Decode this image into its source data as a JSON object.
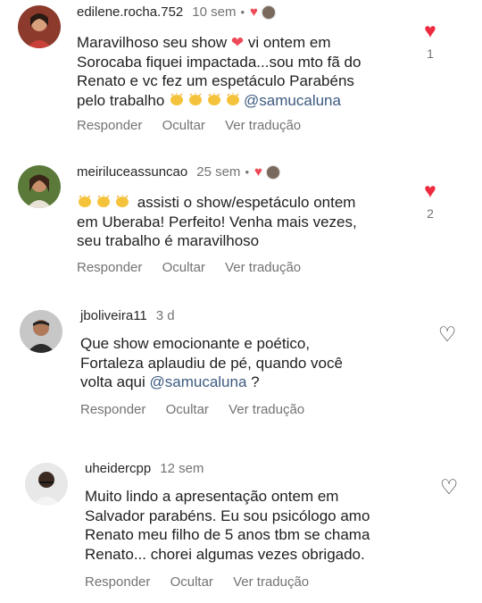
{
  "comments": [
    {
      "username": "edilene.rocha.752",
      "time": "10 sem",
      "dot": "•",
      "text_parts": [
        "Maravilhoso seu show ",
        " vi ontem em\nSorocaba fiquei impactada...sou mto fã do\nRenato e vc fez um espetáculo Parabéns\npelo trabalho "
      ],
      "mention": "@samucaluna",
      "actions": [
        "Responder",
        "Ocultar",
        "Ver tradução"
      ],
      "likes": "1",
      "liked": true
    },
    {
      "username": "meiriluceassuncao",
      "time": "25 sem",
      "dot": "•",
      "text_parts": [
        " assisti o show/espetáculo ontem\nem Uberaba! Perfeito! Venha mais vezes,\nseu trabalho é maravilhoso"
      ],
      "actions": [
        "Responder",
        "Ocultar",
        "Ver tradução"
      ],
      "likes": "2",
      "liked": true
    },
    {
      "username": "jboliveira11",
      "time": "3 d",
      "text_parts": [
        "Que show emocionante e poético,\nFortaleza aplaudiu de pé,  quando você\nvolta aqui "
      ],
      "mention": "@samucaluna",
      "text_after": " ?",
      "actions": [
        "Responder",
        "Ocultar",
        "Ver tradução"
      ],
      "liked": false
    },
    {
      "username": "uheidercpp",
      "time": "12 sem",
      "text_parts": [
        "Muito lindo a apresentação ontem em\nSalvador parabéns.  Eu sou psicólogo amo\nRenato meu filho de 5 anos tbm se chama\nRenato... chorei algumas vezes obrigado."
      ],
      "actions": [
        "Responder",
        "Ocultar",
        "Ver tradução"
      ],
      "liked": false
    }
  ],
  "icons": {
    "heart_filled": "heart-filled-icon",
    "heart_outline": "heart-outline-icon",
    "clap": "clapping-hands-icon",
    "red_heart_emoji": "red-heart-emoji"
  },
  "colors": {
    "like_red": "#ed2a40",
    "mention": "#3d5a80",
    "muted": "#737373"
  }
}
